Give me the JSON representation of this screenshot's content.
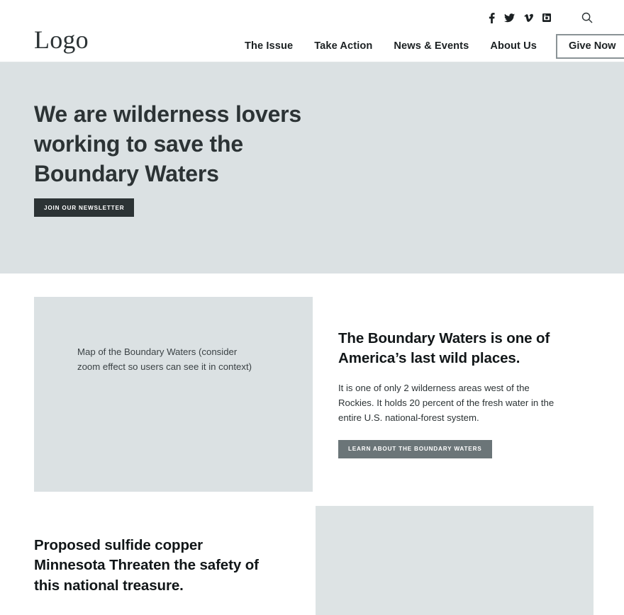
{
  "header": {
    "brand": "Logo",
    "social": [
      {
        "name": "facebook-icon",
        "label": "Facebook"
      },
      {
        "name": "twitter-icon",
        "label": "Twitter"
      },
      {
        "name": "vimeo-icon",
        "label": "Vimeo"
      },
      {
        "name": "instagram-icon",
        "label": "Instagram"
      }
    ],
    "search_label": "Search",
    "nav": [
      {
        "label": "The Issue"
      },
      {
        "label": "Take Action"
      },
      {
        "label": "News & Events"
      },
      {
        "label": "About Us"
      }
    ],
    "cta_label": "Give Now"
  },
  "hero": {
    "title": "We are wilderness lovers working to save the Boundary Waters",
    "cta_label": "Join Our Newsletter",
    "background_color": "#dbe1e3"
  },
  "map_section": {
    "placeholder_text": "Map of the Boundary Waters (consider zoom effect so users can see it in context)",
    "title": "The Boundary Waters is one of America’s last wild places.",
    "body": "It is one of only 2 wilderness areas west of the Rockies. It holds 20 percent of the fresh water in the entire U.S. national-forest system.",
    "cta_label": "Learn About the Boundary Waters"
  },
  "threat_section": {
    "title": "Proposed sulfide copper Minnesota Threaten the safety of this national treasure.",
    "body": ""
  },
  "colors": {
    "accent_panel": "#dbe1e3",
    "dark_button": "#2c3335",
    "gray_button": "#6b7578",
    "text": "#2c3335",
    "heading": "#111618"
  }
}
